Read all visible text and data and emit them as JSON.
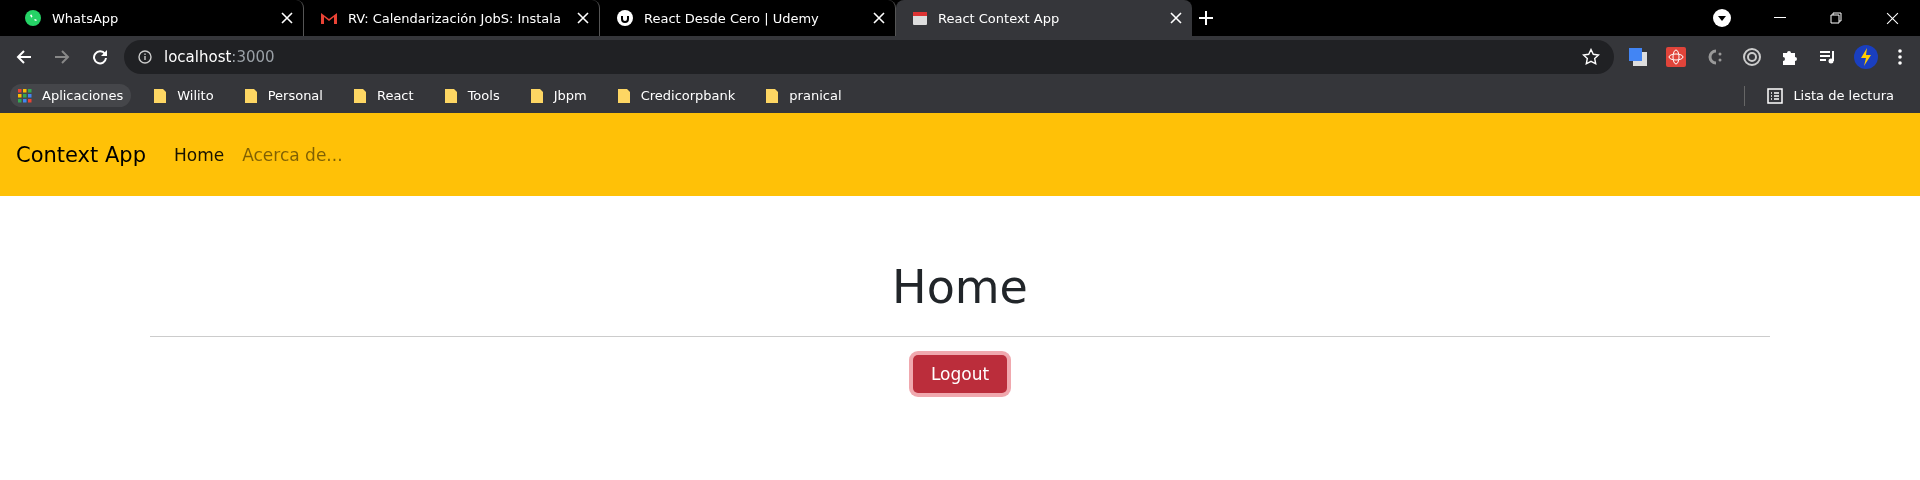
{
  "browser": {
    "tabs": [
      {
        "title": "WhatsApp",
        "kind": "chat",
        "selected": false
      },
      {
        "title": "RV: Calendarización JobS: Instala",
        "kind": "mail",
        "selected": false
      },
      {
        "title": "React Desde Cero | Udemy",
        "kind": "course",
        "selected": false
      },
      {
        "title": "React Context App",
        "kind": "page",
        "selected": true
      }
    ],
    "address": {
      "host": "localhost",
      "port": ":3000"
    },
    "bookmarks": [
      {
        "label": "Aplicaciones",
        "kind": "apps"
      },
      {
        "label": "Wilito",
        "kind": "folder"
      },
      {
        "label": "Personal",
        "kind": "folder"
      },
      {
        "label": "React",
        "kind": "folder"
      },
      {
        "label": "Tools",
        "kind": "folder"
      },
      {
        "label": "Jbpm",
        "kind": "folder"
      },
      {
        "label": "Credicorpbank",
        "kind": "folder"
      },
      {
        "label": "pranical",
        "kind": "folder"
      }
    ],
    "reading_list": "Lista de lectura"
  },
  "navbar": {
    "brand": "Context App",
    "links": [
      {
        "label": "Home",
        "selected": true
      },
      {
        "label": "Acerca de...",
        "selected": false
      }
    ]
  },
  "page": {
    "heading": "Home",
    "button": "Logout"
  }
}
